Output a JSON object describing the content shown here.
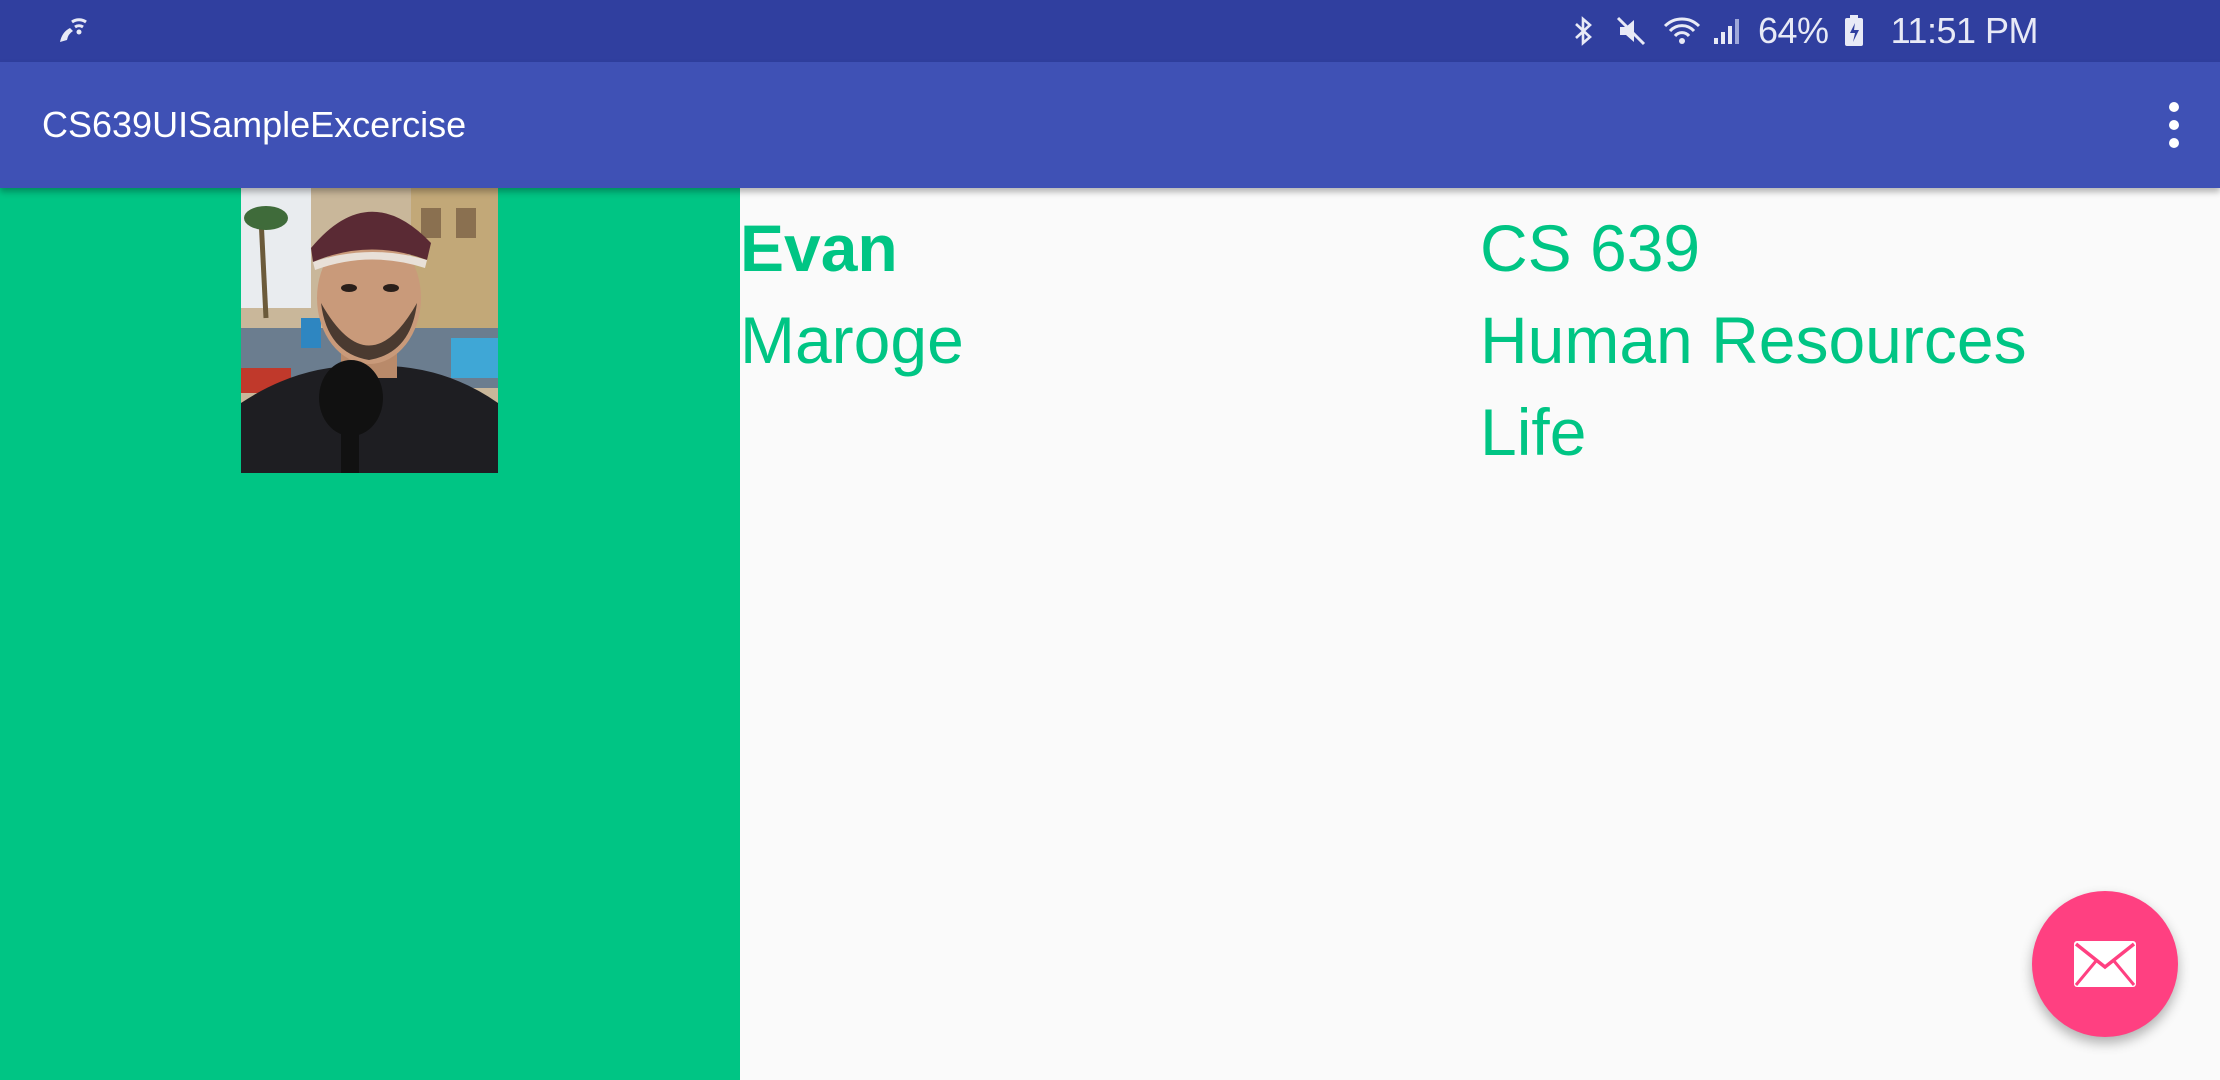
{
  "status_bar": {
    "battery_percent": "64%",
    "time": "11:51 PM",
    "icons": [
      "wifi-calling-icon",
      "bluetooth-icon",
      "mute-icon",
      "wifi-icon",
      "signal-icon",
      "battery-icon"
    ]
  },
  "app_bar": {
    "title": "CS639UISampleExcercise",
    "overflow_icon": "more-vert-icon"
  },
  "profile": {
    "first_name": "Evan",
    "last_name": "Maroge",
    "photo_icon": "profile-photo"
  },
  "course": {
    "lines": [
      "CS 639",
      "Human Resources",
      "Life"
    ]
  },
  "fab": {
    "icon": "mail-icon"
  },
  "colors": {
    "status_bar": "#303f9f",
    "app_bar": "#3f51b5",
    "accent_green": "#00c584",
    "fab_pink": "#ff4081",
    "background": "#fafafa"
  }
}
